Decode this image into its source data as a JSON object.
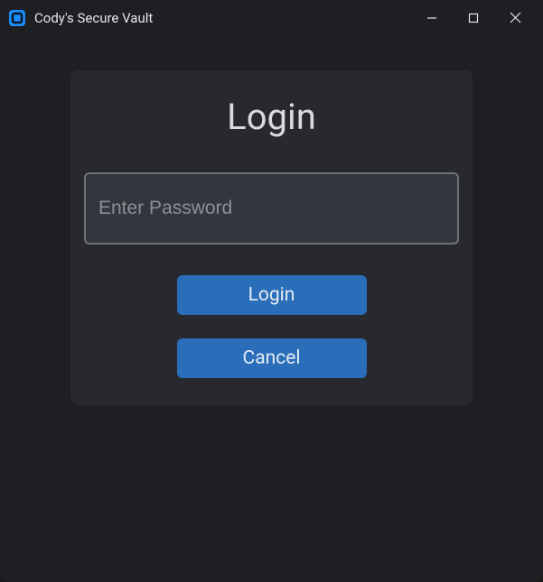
{
  "window": {
    "title": "Cody's Secure Vault"
  },
  "login": {
    "heading": "Login",
    "password_placeholder": "Enter Password",
    "password_value": "",
    "login_button": "Login",
    "cancel_button": "Cancel"
  },
  "colors": {
    "accent": "#2a6db8",
    "window_bg": "#1d1f23",
    "card_bg": "#27292e",
    "input_bg": "#33363c",
    "input_border": "#6f7279"
  },
  "icons": {
    "app": "app-icon",
    "minimize": "minimize-icon",
    "maximize": "maximize-icon",
    "close": "close-icon"
  }
}
